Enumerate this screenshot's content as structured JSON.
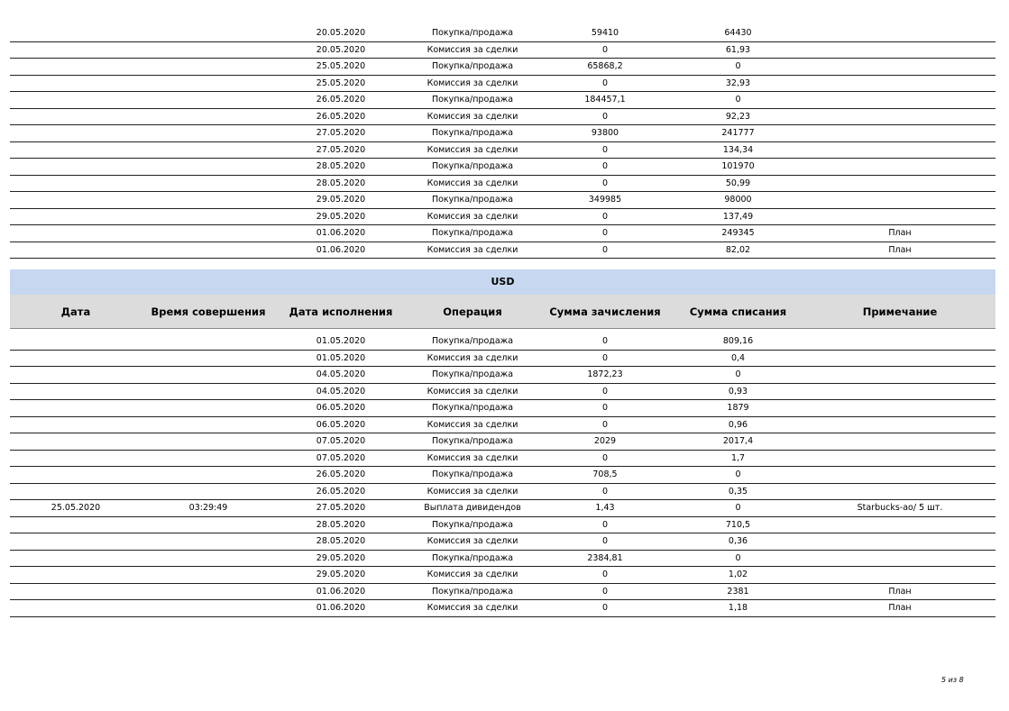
{
  "top_rows": [
    {
      "date": "",
      "time": "",
      "exec_date": "20.05.2020",
      "operation": "Покупка/продажа",
      "credit": "59410",
      "debit": "64430",
      "note": ""
    },
    {
      "date": "",
      "time": "",
      "exec_date": "20.05.2020",
      "operation": "Комиссия за сделки",
      "credit": "0",
      "debit": "61,93",
      "note": ""
    },
    {
      "date": "",
      "time": "",
      "exec_date": "25.05.2020",
      "operation": "Покупка/продажа",
      "credit": "65868,2",
      "debit": "0",
      "note": ""
    },
    {
      "date": "",
      "time": "",
      "exec_date": "25.05.2020",
      "operation": "Комиссия за сделки",
      "credit": "0",
      "debit": "32,93",
      "note": ""
    },
    {
      "date": "",
      "time": "",
      "exec_date": "26.05.2020",
      "operation": "Покупка/продажа",
      "credit": "184457,1",
      "debit": "0",
      "note": ""
    },
    {
      "date": "",
      "time": "",
      "exec_date": "26.05.2020",
      "operation": "Комиссия за сделки",
      "credit": "0",
      "debit": "92,23",
      "note": ""
    },
    {
      "date": "",
      "time": "",
      "exec_date": "27.05.2020",
      "operation": "Покупка/продажа",
      "credit": "93800",
      "debit": "241777",
      "note": ""
    },
    {
      "date": "",
      "time": "",
      "exec_date": "27.05.2020",
      "operation": "Комиссия за сделки",
      "credit": "0",
      "debit": "134,34",
      "note": ""
    },
    {
      "date": "",
      "time": "",
      "exec_date": "28.05.2020",
      "operation": "Покупка/продажа",
      "credit": "0",
      "debit": "101970",
      "note": ""
    },
    {
      "date": "",
      "time": "",
      "exec_date": "28.05.2020",
      "operation": "Комиссия за сделки",
      "credit": "0",
      "debit": "50,99",
      "note": ""
    },
    {
      "date": "",
      "time": "",
      "exec_date": "29.05.2020",
      "operation": "Покупка/продажа",
      "credit": "349985",
      "debit": "98000",
      "note": ""
    },
    {
      "date": "",
      "time": "",
      "exec_date": "29.05.2020",
      "operation": "Комиссия за сделки",
      "credit": "0",
      "debit": "137,49",
      "note": ""
    },
    {
      "date": "",
      "time": "",
      "exec_date": "01.06.2020",
      "operation": "Покупка/продажа",
      "credit": "0",
      "debit": "249345",
      "note": "План"
    },
    {
      "date": "",
      "time": "",
      "exec_date": "01.06.2020",
      "operation": "Комиссия за сделки",
      "credit": "0",
      "debit": "82,02",
      "note": "План"
    }
  ],
  "usd_section": {
    "title": "USD",
    "headers": {
      "date": "Дата",
      "time": "Время совершения",
      "exec_date": "Дата исполнения",
      "operation": "Операция",
      "credit": "Сумма зачисления",
      "debit": "Сумма списания",
      "note": "Примечание"
    },
    "rows": [
      {
        "date": "",
        "time": "",
        "exec_date": "01.05.2020",
        "operation": "Покупка/продажа",
        "credit": "0",
        "debit": "809,16",
        "note": ""
      },
      {
        "date": "",
        "time": "",
        "exec_date": "01.05.2020",
        "operation": "Комиссия за сделки",
        "credit": "0",
        "debit": "0,4",
        "note": ""
      },
      {
        "date": "",
        "time": "",
        "exec_date": "04.05.2020",
        "operation": "Покупка/продажа",
        "credit": "1872,23",
        "debit": "0",
        "note": ""
      },
      {
        "date": "",
        "time": "",
        "exec_date": "04.05.2020",
        "operation": "Комиссия за сделки",
        "credit": "0",
        "debit": "0,93",
        "note": ""
      },
      {
        "date": "",
        "time": "",
        "exec_date": "06.05.2020",
        "operation": "Покупка/продажа",
        "credit": "0",
        "debit": "1879",
        "note": ""
      },
      {
        "date": "",
        "time": "",
        "exec_date": "06.05.2020",
        "operation": "Комиссия за сделки",
        "credit": "0",
        "debit": "0,96",
        "note": ""
      },
      {
        "date": "",
        "time": "",
        "exec_date": "07.05.2020",
        "operation": "Покупка/продажа",
        "credit": "2029",
        "debit": "2017,4",
        "note": ""
      },
      {
        "date": "",
        "time": "",
        "exec_date": "07.05.2020",
        "operation": "Комиссия за сделки",
        "credit": "0",
        "debit": "1,7",
        "note": ""
      },
      {
        "date": "",
        "time": "",
        "exec_date": "26.05.2020",
        "operation": "Покупка/продажа",
        "credit": "708,5",
        "debit": "0",
        "note": ""
      },
      {
        "date": "",
        "time": "",
        "exec_date": "26.05.2020",
        "operation": "Комиссия за сделки",
        "credit": "0",
        "debit": "0,35",
        "note": ""
      },
      {
        "date": "25.05.2020",
        "time": "03:29:49",
        "exec_date": "27.05.2020",
        "operation": "Выплата дивидендов",
        "credit": "1,43",
        "debit": "0",
        "note": "Starbucks-ao/ 5 шт."
      },
      {
        "date": "",
        "time": "",
        "exec_date": "28.05.2020",
        "operation": "Покупка/продажа",
        "credit": "0",
        "debit": "710,5",
        "note": ""
      },
      {
        "date": "",
        "time": "",
        "exec_date": "28.05.2020",
        "operation": "Комиссия за сделки",
        "credit": "0",
        "debit": "0,36",
        "note": ""
      },
      {
        "date": "",
        "time": "",
        "exec_date": "29.05.2020",
        "operation": "Покупка/продажа",
        "credit": "2384,81",
        "debit": "0",
        "note": ""
      },
      {
        "date": "",
        "time": "",
        "exec_date": "29.05.2020",
        "operation": "Комиссия за сделки",
        "credit": "0",
        "debit": "1,02",
        "note": ""
      },
      {
        "date": "",
        "time": "",
        "exec_date": "01.06.2020",
        "operation": "Покупка/продажа",
        "credit": "0",
        "debit": "2381",
        "note": "План"
      },
      {
        "date": "",
        "time": "",
        "exec_date": "01.06.2020",
        "operation": "Комиссия за сделки",
        "credit": "0",
        "debit": "1,18",
        "note": "План"
      }
    ]
  },
  "footer": {
    "page_number": "5 из 8"
  }
}
